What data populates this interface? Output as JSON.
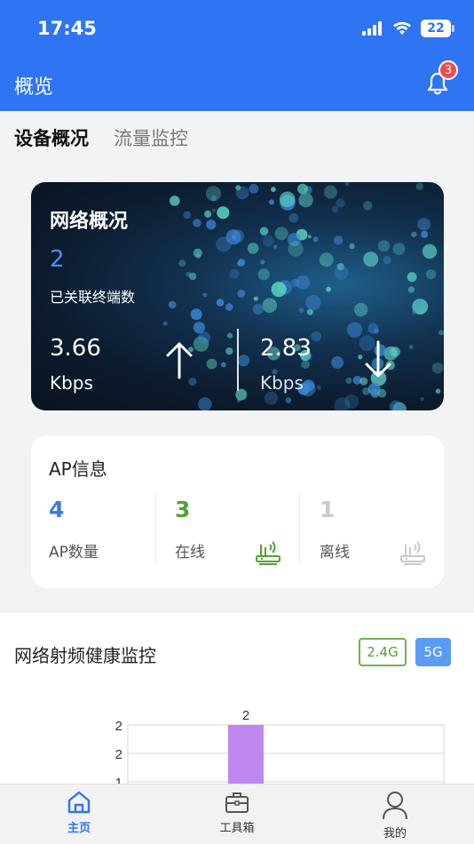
{
  "status_bar": {
    "time": "17:45",
    "battery": "22"
  },
  "header": {
    "title": "概览",
    "notification_count": "3"
  },
  "tabs": [
    {
      "label": "设备概况",
      "active": true
    },
    {
      "label": "流量监控",
      "active": false
    }
  ],
  "network_card": {
    "title": "网络概况",
    "connected_count": "2",
    "connected_label": "已关联终端数",
    "upload_value": "3.66",
    "upload_unit": "Kbps",
    "download_value": "2.83",
    "download_unit": "Kbps"
  },
  "ap_info": {
    "title": "AP信息",
    "total": {
      "value": "4",
      "label": "AP数量",
      "color": "#3f78d6"
    },
    "online": {
      "value": "3",
      "label": "在线",
      "color": "#4fa236"
    },
    "offline": {
      "value": "1",
      "label": "离线",
      "color": "#c9c9c9"
    }
  },
  "health": {
    "title": "网络射频健康监控",
    "band_24": "2.4G",
    "band_5g": "5G"
  },
  "chart_data": {
    "type": "bar",
    "categories": [
      ""
    ],
    "values": [
      2
    ],
    "data_labels": [
      "2"
    ],
    "y_ticks": [
      "2",
      "2",
      "1"
    ],
    "bar_color": "#c086f0"
  },
  "bottom_nav": [
    {
      "label": "主页",
      "icon": "home-icon",
      "active": true
    },
    {
      "label": "工具箱",
      "icon": "toolbox-icon",
      "active": false
    },
    {
      "label": "我的",
      "icon": "profile-icon",
      "active": false
    }
  ]
}
